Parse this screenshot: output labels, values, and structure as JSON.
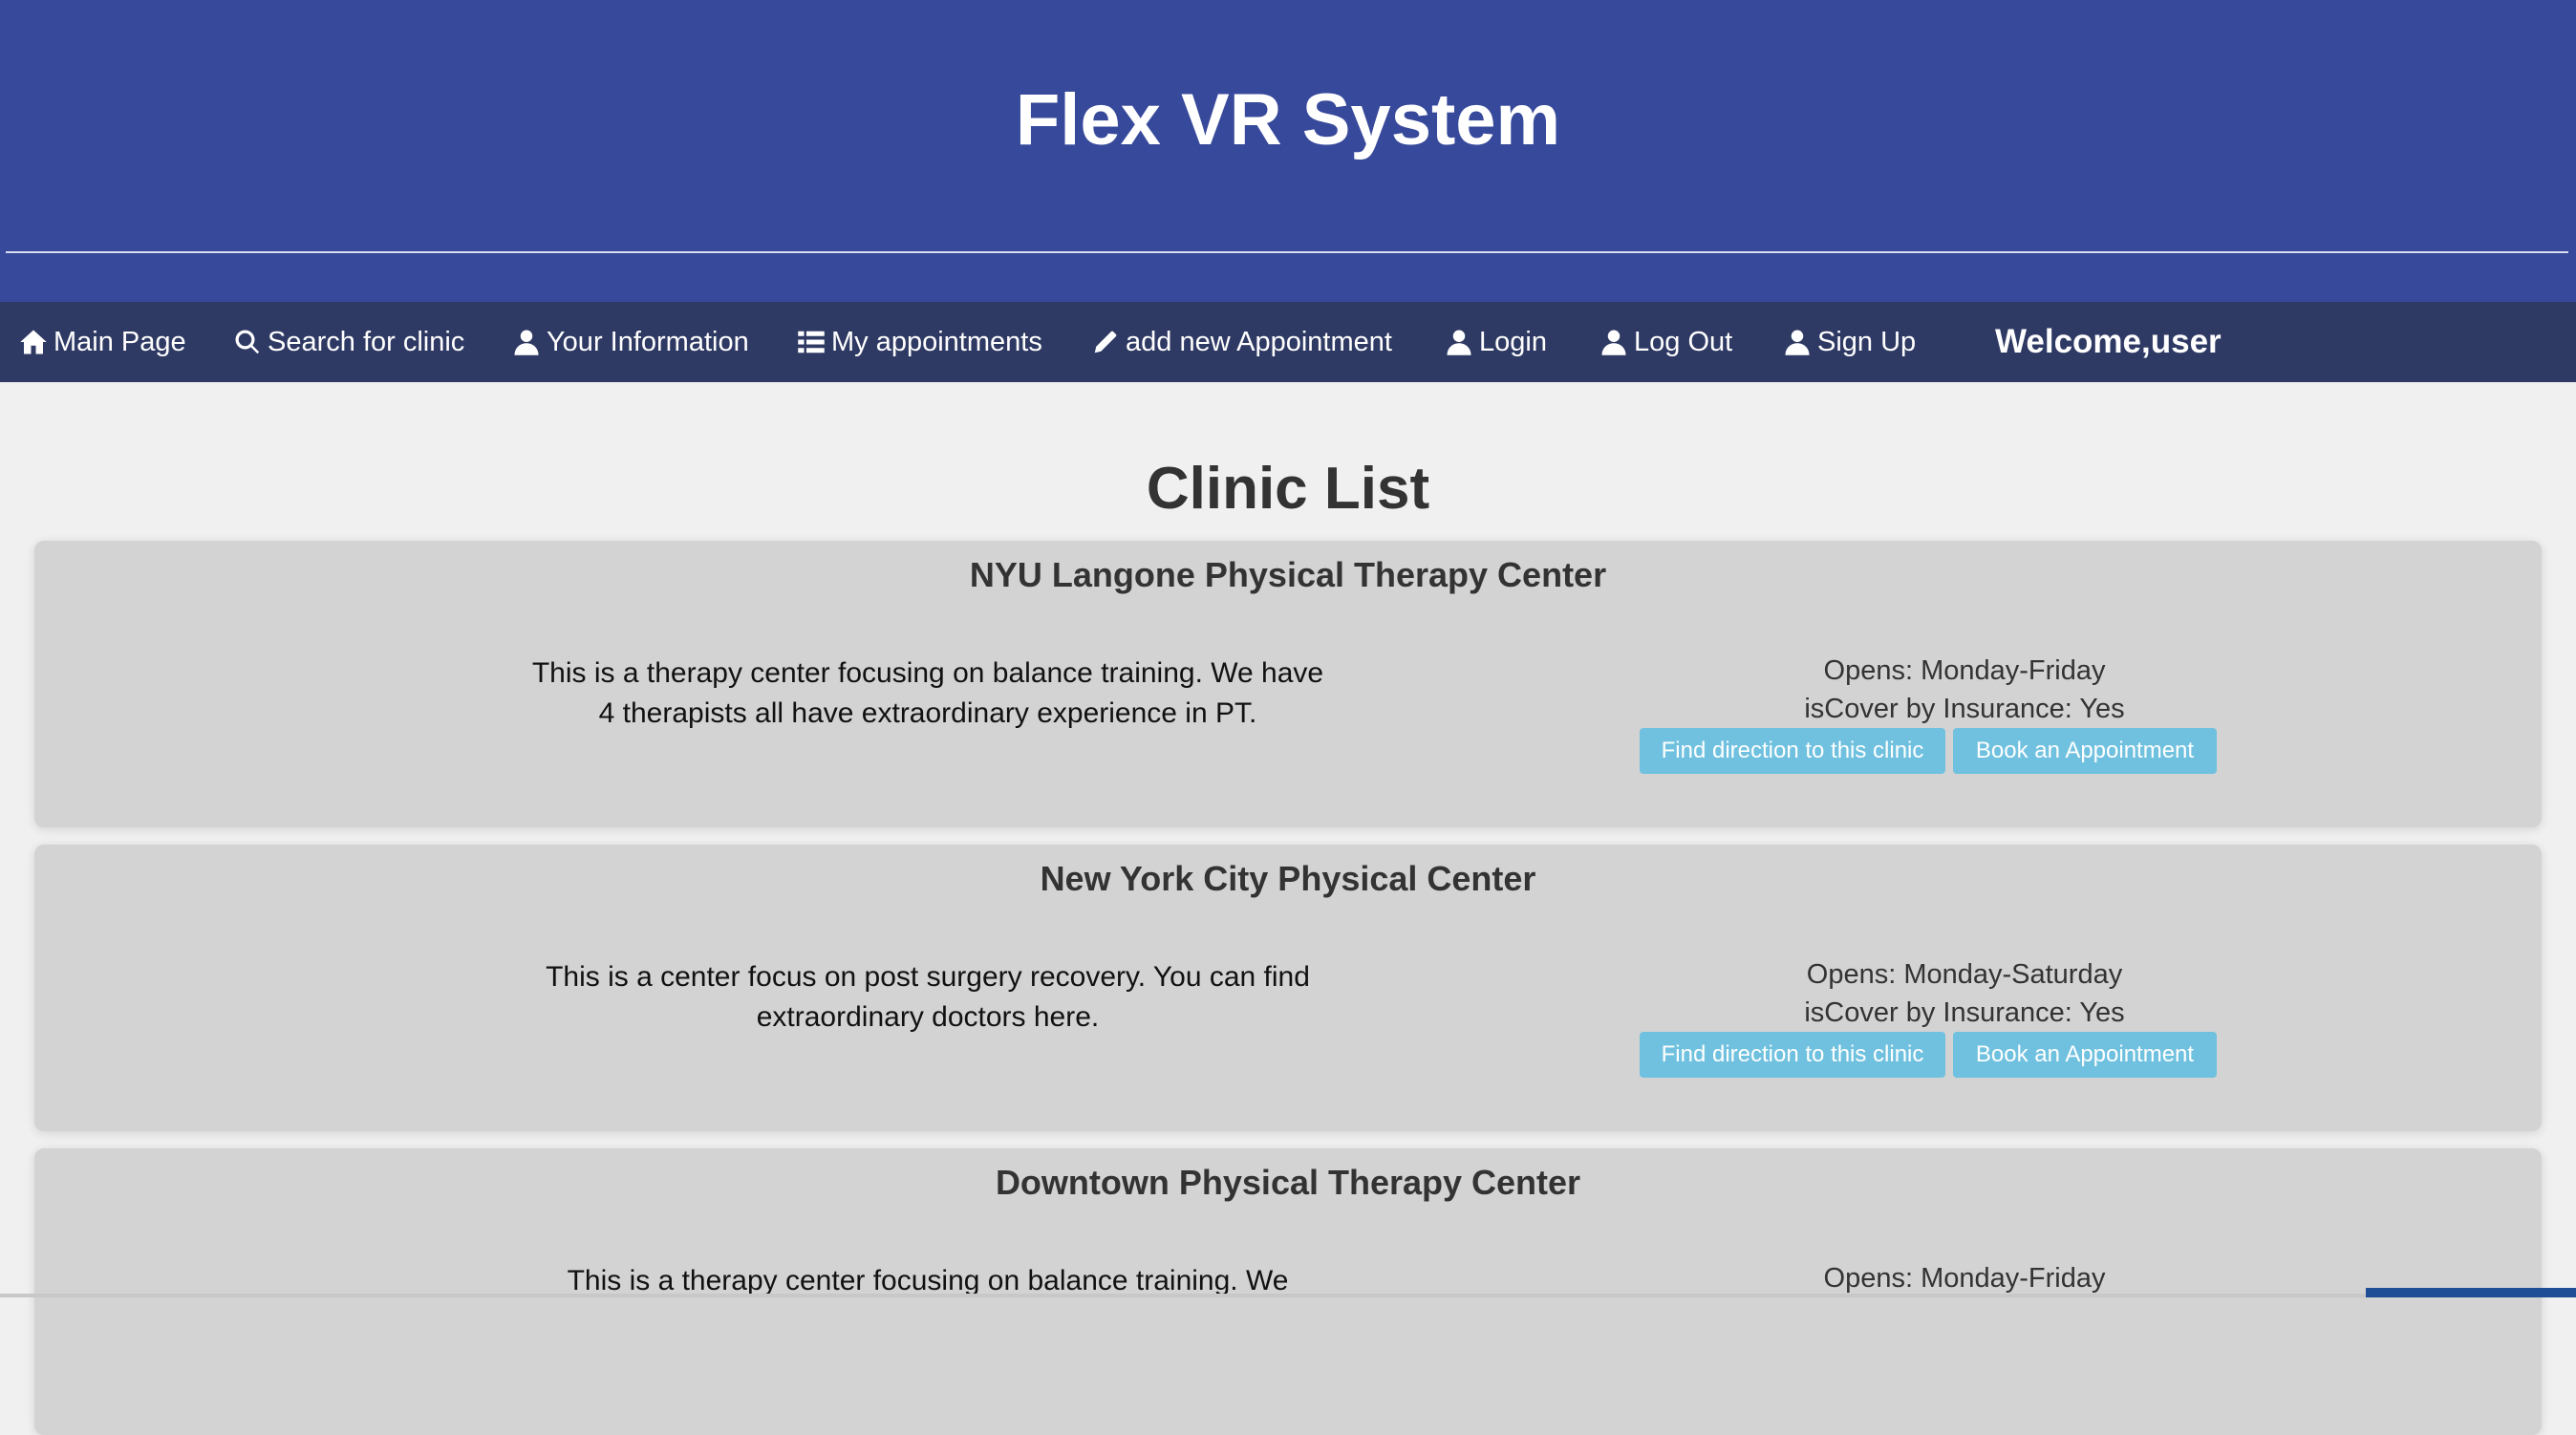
{
  "header": {
    "title": "Flex VR System"
  },
  "nav": {
    "items": [
      {
        "label": "Main Page",
        "icon": "home-icon"
      },
      {
        "label": "Search for clinic",
        "icon": "search-icon"
      },
      {
        "label": "Your Information",
        "icon": "user-icon"
      },
      {
        "label": "My appointments",
        "icon": "list-icon"
      },
      {
        "label": "add new Appointment",
        "icon": "pencil-icon"
      },
      {
        "label": "Login",
        "icon": "user-icon"
      },
      {
        "label": "Log Out",
        "icon": "user-icon"
      },
      {
        "label": "Sign Up",
        "icon": "user-icon"
      }
    ],
    "welcome": "Welcome,user"
  },
  "main": {
    "title": "Clinic List",
    "clinics": [
      {
        "name": "NYU Langone Physical Therapy Center",
        "description": "This is a therapy center focusing on balance training. We have 4 therapists all have extraordinary experience in PT.",
        "opens": "Opens: Monday-Friday",
        "insurance": "isCover by Insurance: Yes",
        "direction_label": "Find direction to this clinic",
        "book_label": "Book an Appointment"
      },
      {
        "name": "New York City Physical Center",
        "description": "This is a center focus on post surgery recovery. You can find extraordinary doctors here.",
        "opens": "Opens: Monday-Saturday",
        "insurance": "isCover by Insurance: Yes",
        "direction_label": "Find direction to this clinic",
        "book_label": "Book an Appointment"
      },
      {
        "name": "Downtown Physical Therapy Center",
        "description": "This is a therapy center focusing on balance training. We",
        "opens": "Opens: Monday-Friday",
        "insurance": "",
        "direction_label": "",
        "book_label": ""
      }
    ]
  },
  "colors": {
    "header_bg": "#37499b",
    "nav_bg": "#2f3a64",
    "card_bg": "#d3d3d3",
    "button_bg": "#6fc1df",
    "page_bg": "#f0f0f0"
  }
}
